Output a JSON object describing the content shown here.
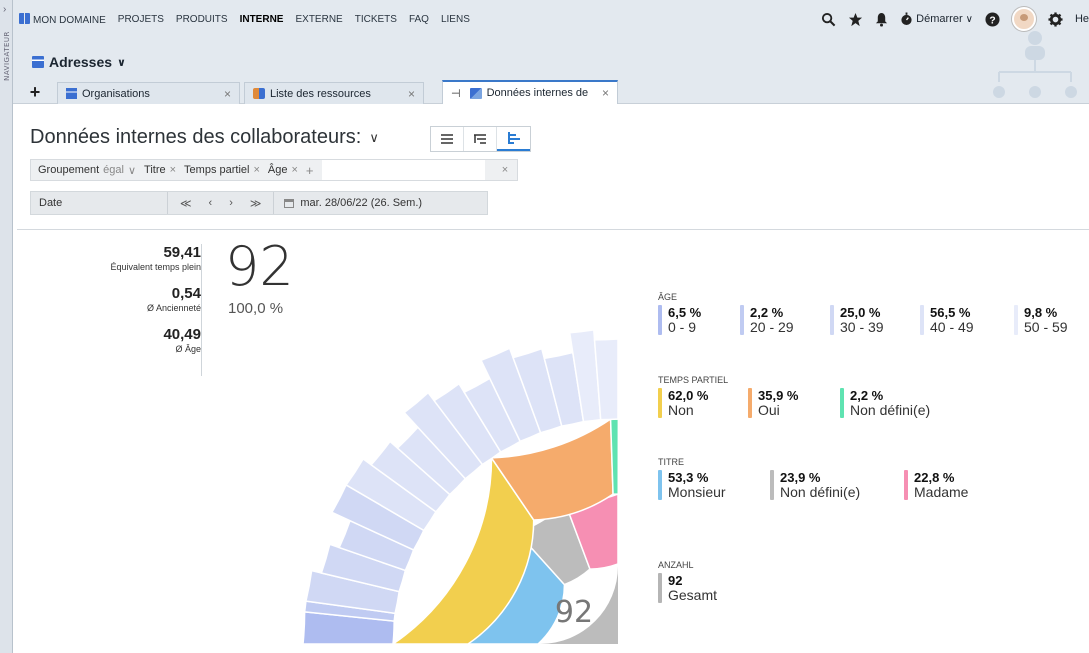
{
  "navigator_label": "NAVIGATEUR",
  "topnav": {
    "items": [
      {
        "label": "MON DOMAINE",
        "active": false
      },
      {
        "label": "PROJETS",
        "active": false
      },
      {
        "label": "PRODUITS",
        "active": false
      },
      {
        "label": "INTERNE",
        "active": true
      },
      {
        "label": "EXTERNE",
        "active": false
      },
      {
        "label": "TICKETS",
        "active": false
      },
      {
        "label": "FAQ",
        "active": false
      },
      {
        "label": "LIENS",
        "active": false
      }
    ],
    "demarrer_label": "Démarrer",
    "help_label": "He"
  },
  "section": {
    "title": "Adresses"
  },
  "tabs": [
    {
      "label": "Organisations"
    },
    {
      "label": "Liste des ressources"
    },
    {
      "label": "Données internes de"
    }
  ],
  "page": {
    "title": "Données internes des collaborateurs:"
  },
  "filters": {
    "group_label": "Groupement",
    "group_op": "égal",
    "chips": [
      "Titre",
      "Temps partiel",
      "Âge"
    ]
  },
  "datebar": {
    "label": "Date",
    "value": "mar. 28/06/22 (26. Sem.)"
  },
  "stats": [
    {
      "value": "59,41",
      "label": "Équivalent temps plein"
    },
    {
      "value": "0,54",
      "label": "Ø Ancienneté"
    },
    {
      "value": "40,49",
      "label": "Ø Âge"
    }
  ],
  "total": {
    "value": "92",
    "pct": "100,0 %"
  },
  "chart_data": {
    "type": "sunburst",
    "center_value": "92",
    "rings": [
      {
        "name": "TITRE",
        "segments": [
          {
            "label": "Monsieur",
            "pct": 53.3,
            "color": "#7ec3ee"
          },
          {
            "label": "Non défini(e)",
            "pct": 23.9,
            "color": "#bcbcbc"
          },
          {
            "label": "Madame",
            "pct": 22.8,
            "color": "#f68fb3"
          }
        ]
      },
      {
        "name": "TEMPS PARTIEL",
        "segments": [
          {
            "label": "Non",
            "pct": 62.0,
            "color": "#f2cf4e"
          },
          {
            "label": "Oui",
            "pct": 35.9,
            "color": "#f5ab6c"
          },
          {
            "label": "Non défini(e)",
            "pct": 2.2,
            "color": "#5fe3b1"
          }
        ]
      },
      {
        "name": "ÂGE",
        "segments": [
          {
            "label": "0 - 9",
            "pct": 6.5,
            "color": "#aebcf0"
          },
          {
            "label": "20 - 29",
            "pct": 2.2,
            "color": "#c0cbf2"
          },
          {
            "label": "30 - 39",
            "pct": 25.0,
            "color": "#d0d8f4"
          },
          {
            "label": "40 - 49",
            "pct": 56.5,
            "color": "#dde3f7"
          },
          {
            "label": "50 - 59",
            "pct": 9.8,
            "color": "#e8ecfa"
          }
        ]
      }
    ]
  },
  "legends": {
    "age": {
      "title": "ÂGE",
      "items": [
        {
          "pct": "6,5 %",
          "label": "0 - 9",
          "color": "#aebcf0"
        },
        {
          "pct": "2,2 %",
          "label": "20 - 29",
          "color": "#c0cbf2"
        },
        {
          "pct": "25,0 %",
          "label": "30 - 39",
          "color": "#d0d8f4"
        },
        {
          "pct": "56,5 %",
          "label": "40 - 49",
          "color": "#dde3f7"
        },
        {
          "pct": "9,8 %",
          "label": "50 - 59",
          "color": "#e8ecfa"
        }
      ]
    },
    "temps": {
      "title": "TEMPS PARTIEL",
      "items": [
        {
          "pct": "62,0 %",
          "label": "Non",
          "color": "#f2cf4e"
        },
        {
          "pct": "35,9 %",
          "label": "Oui",
          "color": "#f5ab6c"
        },
        {
          "pct": "2,2 %",
          "label": "Non défini(e)",
          "color": "#5fe3b1"
        }
      ]
    },
    "titre": {
      "title": "TITRE",
      "items": [
        {
          "pct": "53,3 %",
          "label": "Monsieur",
          "color": "#7ec3ee"
        },
        {
          "pct": "23,9 %",
          "label": "Non défini(e)",
          "color": "#bcbcbc"
        },
        {
          "pct": "22,8 %",
          "label": "Madame",
          "color": "#f68fb3"
        }
      ]
    },
    "anzahl": {
      "title": "ANZAHL",
      "items": [
        {
          "pct": "92",
          "label": "Gesamt",
          "color": "#b5b5b5"
        }
      ]
    }
  }
}
